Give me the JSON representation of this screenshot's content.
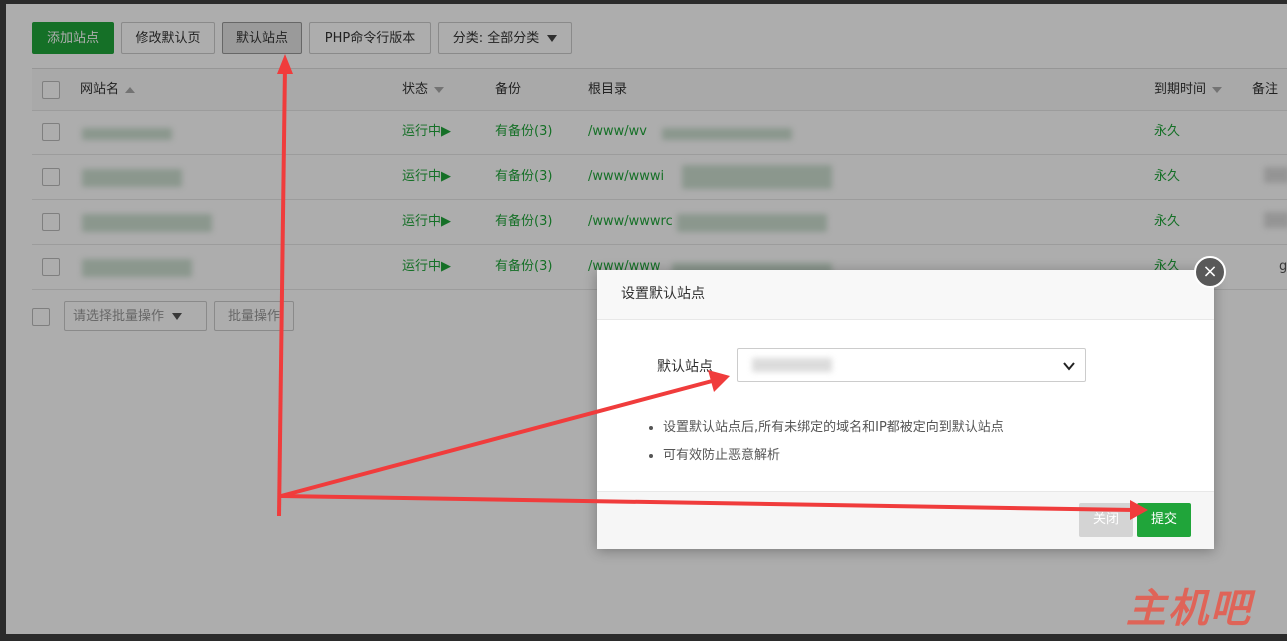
{
  "toolbar": {
    "add_site": "添加站点",
    "edit_default_page": "修改默认页",
    "default_site": "默认站点",
    "php_cli_version": "PHP命令行版本",
    "category": "分类: 全部分类"
  },
  "table": {
    "headers": {
      "site_name": "网站名",
      "status": "状态",
      "backup": "备份",
      "root": "根目录",
      "expire": "到期时间",
      "note": "备注"
    },
    "rows": [
      {
        "status": "运行中▶",
        "backup": "有备份(3)",
        "root": "/www/wv",
        "expire": "永久",
        "note": ""
      },
      {
        "status": "运行中▶",
        "backup": "有备份(3)",
        "root": "/www/wwwi",
        "expire": "永久",
        "note": ""
      },
      {
        "status": "运行中▶",
        "backup": "有备份(3)",
        "root": "/www/wwwrc",
        "expire": "永久",
        "note": ""
      },
      {
        "status": "运行中▶",
        "backup": "有备份(3)",
        "root": "/www/www",
        "expire": "永久",
        "note": "g"
      }
    ]
  },
  "batch": {
    "select_placeholder": "请选择批量操作",
    "batch_button": "批量操作"
  },
  "dialog": {
    "title": "设置默认站点",
    "field_label": "默认站点",
    "select_value": "",
    "tips": [
      "设置默认站点后,所有未绑定的域名和IP都被定向到默认站点",
      "可有效防止恶意解析"
    ],
    "close_button": "关闭",
    "submit_button": "提交",
    "close_icon": "×"
  },
  "watermark": "主机吧",
  "colors": {
    "accent": "#20a53a",
    "annotation_arrow": "#f03c3c"
  }
}
